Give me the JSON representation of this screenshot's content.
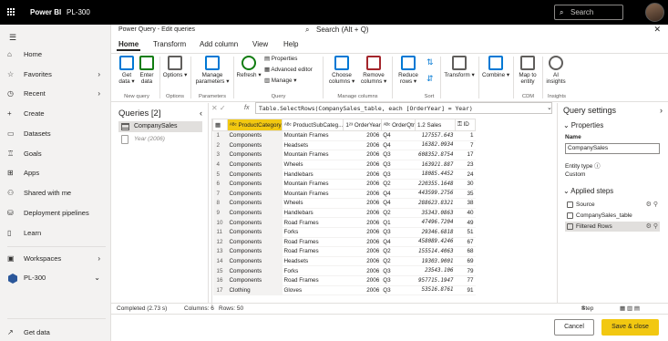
{
  "app": {
    "brand": "Power BI",
    "workspace": "PL-300",
    "search_placeholder": "Search"
  },
  "nav": {
    "items": [
      {
        "icon": "home-icon",
        "glyph": "⌂",
        "label": "Home"
      },
      {
        "icon": "star-icon",
        "glyph": "☆",
        "label": "Favorites"
      },
      {
        "icon": "clock-icon",
        "glyph": "◷",
        "label": "Recent"
      },
      {
        "icon": "plus-icon",
        "glyph": "+",
        "label": "Create"
      },
      {
        "icon": "datasets-icon",
        "glyph": "▭",
        "label": "Datasets"
      },
      {
        "icon": "trophy-icon",
        "glyph": "♖",
        "label": "Goals"
      },
      {
        "icon": "apps-icon",
        "glyph": "⊞",
        "label": "Apps"
      },
      {
        "icon": "shared-icon",
        "glyph": "⚇",
        "label": "Shared with me"
      },
      {
        "icon": "pipeline-icon",
        "glyph": "⛁",
        "label": "Deployment pipelines"
      },
      {
        "icon": "book-icon",
        "glyph": "▯",
        "label": "Learn"
      },
      {
        "icon": "workspaces-icon",
        "glyph": "▣",
        "label": "Workspaces"
      },
      {
        "icon": "pl300-workspace-icon",
        "glyph": "",
        "label": "PL-300"
      },
      {
        "icon": "get-data-icon",
        "glyph": "↗",
        "label": "Get data"
      }
    ]
  },
  "dialog": {
    "title": "Power Query - Edit queries",
    "search": "Search (Alt + Q)"
  },
  "tabs": [
    "Home",
    "Transform",
    "Add column",
    "View",
    "Help"
  ],
  "ribbon": {
    "buttons": [
      {
        "label": "Get data ▾",
        "color": "#0078d4"
      },
      {
        "label": "Enter data",
        "color": "#107c10"
      },
      {
        "label": "Options ▾",
        "color": "#605e5c"
      },
      {
        "label": "Manage parameters ▾",
        "color": "#0078d4"
      },
      {
        "label": "Refresh ▾",
        "color": "#107c10"
      },
      {
        "label": "Choose columns ▾",
        "color": "#0078d4"
      },
      {
        "label": "Remove columns ▾",
        "color": "#a4262c"
      },
      {
        "label": "Reduce rows ▾",
        "color": "#0078d4"
      },
      {
        "label": "Transform ▾",
        "color": "#605e5c"
      },
      {
        "label": "Combine ▾",
        "color": "#0078d4"
      },
      {
        "label": "Map to entity",
        "color": "#605e5c"
      },
      {
        "label": "AI insights",
        "color": "#605e5c"
      }
    ],
    "query_small": [
      "Properties",
      "Advanced editor",
      "Manage ▾"
    ],
    "groups": [
      "New query",
      "Options",
      "Parameters",
      "Query",
      "Manage columns",
      "Sort",
      "CDM",
      "Insights"
    ]
  },
  "queries": {
    "header": "Queries [2]",
    "items": [
      "CompanySales",
      "Year (2006)"
    ]
  },
  "formula": {
    "fx": "fx",
    "text": "Table.SelectRows(CompanySales_table, each [OrderYear] = Year)"
  },
  "grid": {
    "columns": [
      "ProductCategory",
      "ProductSubCateg...",
      "OrderYear",
      "OrderQtr",
      "Sales",
      "ID"
    ],
    "rows": [
      [
        "1",
        "Components",
        "Mountain Frames",
        "2006",
        "Q4",
        "127557.643",
        "1"
      ],
      [
        "2",
        "Components",
        "Headsets",
        "2006",
        "Q4",
        "16382.0934",
        "7"
      ],
      [
        "3",
        "Components",
        "Mountain Frames",
        "2006",
        "Q3",
        "608352.8754",
        "17"
      ],
      [
        "4",
        "Components",
        "Wheels",
        "2006",
        "Q3",
        "163921.887",
        "23"
      ],
      [
        "5",
        "Components",
        "Handlebars",
        "2006",
        "Q3",
        "18085.4452",
        "24"
      ],
      [
        "6",
        "Components",
        "Mountain Frames",
        "2006",
        "Q2",
        "220355.1648",
        "30"
      ],
      [
        "7",
        "Components",
        "Mountain Frames",
        "2006",
        "Q4",
        "443599.2756",
        "35"
      ],
      [
        "8",
        "Components",
        "Wheels",
        "2006",
        "Q4",
        "288623.8321",
        "38"
      ],
      [
        "9",
        "Components",
        "Handlebars",
        "2006",
        "Q2",
        "35343.0863",
        "40"
      ],
      [
        "10",
        "Components",
        "Road Frames",
        "2006",
        "Q1",
        "47496.7204",
        "49"
      ],
      [
        "11",
        "Components",
        "Forks",
        "2006",
        "Q3",
        "29346.6818",
        "51"
      ],
      [
        "12",
        "Components",
        "Road Frames",
        "2006",
        "Q4",
        "458089.4246",
        "67"
      ],
      [
        "13",
        "Components",
        "Road Frames",
        "2006",
        "Q2",
        "155514.4063",
        "68"
      ],
      [
        "14",
        "Components",
        "Headsets",
        "2006",
        "Q2",
        "19303.9001",
        "69"
      ],
      [
        "15",
        "Components",
        "Forks",
        "2006",
        "Q3",
        "23543.106",
        "79"
      ],
      [
        "16",
        "Components",
        "Road Frames",
        "2006",
        "Q3",
        "957715.1947",
        "77"
      ],
      [
        "17",
        "Clothing",
        "Gloves",
        "2006",
        "Q3",
        "53516.8761",
        "91"
      ]
    ]
  },
  "settings": {
    "header": "Query settings",
    "properties": "Properties",
    "name_label": "Name",
    "name_value": "CompanySales",
    "entity_label": "Entity type",
    "entity_value": "Custom",
    "applied": "Applied steps",
    "steps": [
      "Source",
      "CompanySales_table",
      "Filtered Rows"
    ]
  },
  "status": {
    "completed": "Completed (2.73 s)",
    "columns": "Columns: 6",
    "rows": "Rows: 50",
    "step": "Step"
  },
  "footer": {
    "cancel": "Cancel",
    "save": "Save & close"
  }
}
